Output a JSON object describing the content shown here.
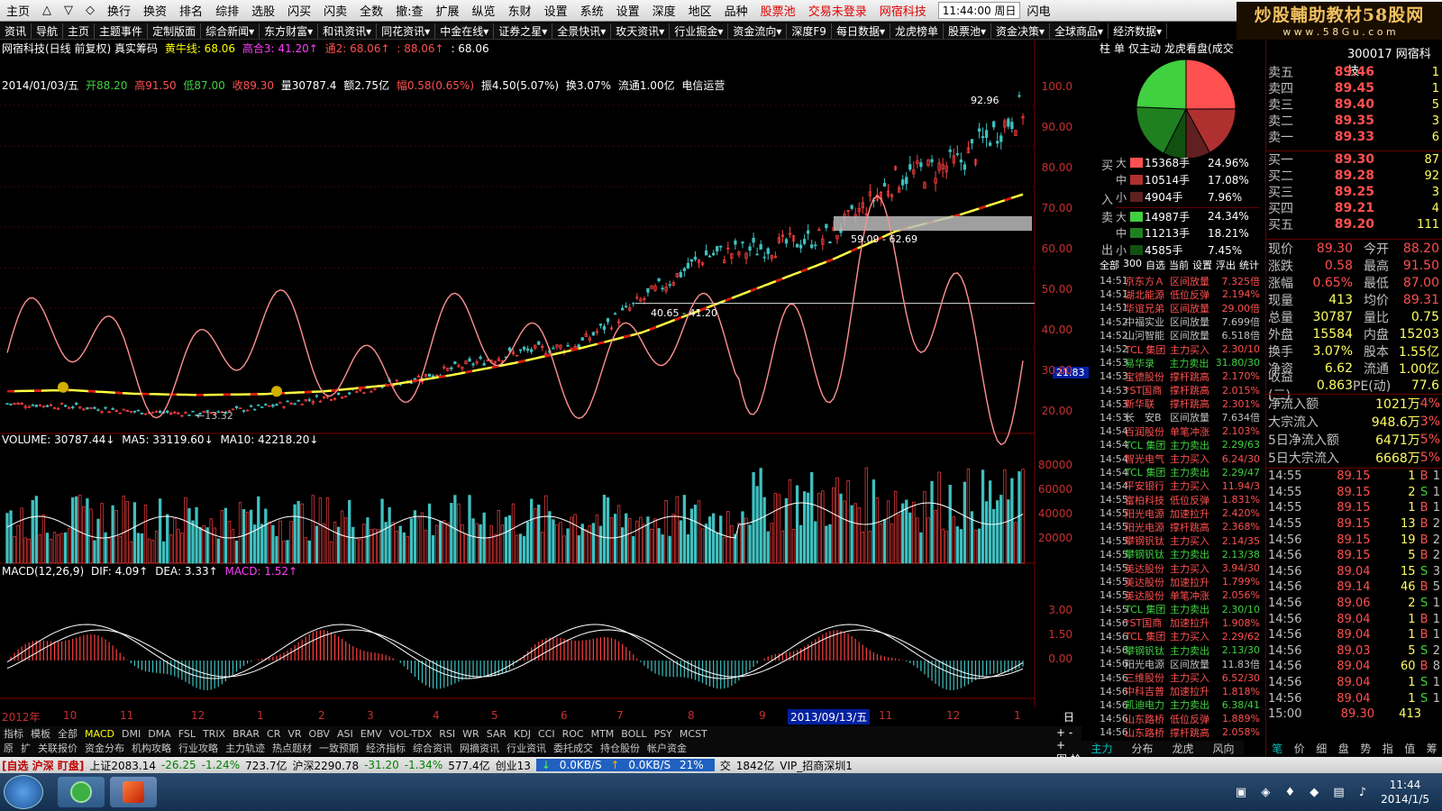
{
  "menu": {
    "items": [
      "主页",
      "△",
      "▽",
      "◇",
      "换行",
      "换资",
      "排名",
      "综排",
      "选股",
      "闪买",
      "闪卖",
      "全数",
      "撤:查",
      "扩展",
      "纵览",
      "东财",
      "设置",
      "系统",
      "设置",
      "深度",
      "地区",
      "品种"
    ],
    "red_items": [
      "股票池",
      "交易未登录",
      "网宿科技"
    ],
    "clock": "11:44:00 周日",
    "right": "闪电"
  },
  "watermark": {
    "title": "炒股輔助教材58股网",
    "url": "w w w . 5 8 G u . c o m"
  },
  "toolbar": [
    "资讯",
    "导航",
    "主页",
    "主题事件",
    "定制版面",
    "综合新闻▾",
    "东方财富▾",
    "和讯资讯▾",
    "同花资讯▾",
    "中金在线▾",
    "证券之星▾",
    "全景快讯▾",
    "玫天资讯▾",
    "行业掘金▾",
    "资金流向▾",
    "深度F9",
    "每日数据▾",
    "龙虎榜单",
    "股票池▾",
    "资金决策▾",
    "全球商品▾",
    "经济数据▾"
  ],
  "chart_header": {
    "stock": "网宿科技(日线 前复权) 真实筹码",
    "l1": "黄牛线: 68.06",
    "l2": "高合3: 41.20↑",
    "l3": "通2: 68.06↑",
    "l4": ": 88.06↑",
    "l5": ": 68.06"
  },
  "ohlc_bar": {
    "date": "2014/01/03/五",
    "open": "开88.20",
    "high": "高91.50",
    "low": "低87.00",
    "close": "收89.30",
    "vol": "量30787.4",
    "amt": "额2.75亿",
    "chg": "幅0.58(0.65%)",
    "amp": "振4.50(5.07%)",
    "turn": "换3.07%",
    "float": "流通1.00亿",
    "ind": "电信运营"
  },
  "price_axis": [
    "100.0",
    "90.00",
    "80.00",
    "70.00",
    "60.00",
    "50.00",
    "40.00",
    "30.00",
    "20.00"
  ],
  "annotations": {
    "hi": "92.96",
    "band1": "59.09 - 62.69",
    "band2": "40.65 - 41.20",
    "low": "←13.32",
    "cur": "21.83"
  },
  "volume": {
    "label": "VOLUME: 30787.44↓",
    "ma5": "MA5: 33119.60↓",
    "ma10": "MA10: 42218.20↓",
    "axis": [
      "80000",
      "60000",
      "40000",
      "20000"
    ]
  },
  "macd": {
    "label": "MACD(12,26,9)",
    "dif": "DIF: 4.09↑",
    "dea": "DEA: 3.33↑",
    "macd": "MACD: 1.52↑",
    "axis": [
      "3.00",
      "1.50",
      "0.00"
    ]
  },
  "time_axis": [
    "2012年",
    "10",
    "11",
    "12",
    "1",
    "2",
    "3",
    "4",
    "5",
    "6",
    "7",
    "8",
    "9",
    "2013/09/13/五",
    "11",
    "12",
    "1"
  ],
  "time_axis_right": "日线",
  "chart_data": {
    "type": "candlestick",
    "title": "网宿科技(日线 前复权)",
    "ylim": [
      13,
      100
    ],
    "x": [
      "2012-09",
      "2012-10",
      "2012-11",
      "2012-12",
      "2013-01",
      "2013-02",
      "2013-03",
      "2013-04",
      "2013-05",
      "2013-06",
      "2013-07",
      "2013-08",
      "2013-09",
      "2013-10",
      "2013-11",
      "2013-12",
      "2014-01"
    ],
    "series": [
      {
        "name": "收盘",
        "values": [
          16.5,
          15.8,
          14.5,
          14.0,
          15.5,
          18.0,
          21.0,
          25.0,
          29.0,
          31.0,
          42.0,
          53.0,
          55.0,
          58.0,
          72.0,
          76.0,
          89.3
        ]
      },
      {
        "name": "黄牛线",
        "values": [
          19.5,
          19.8,
          18.9,
          18.6,
          18.8,
          19.5,
          21.0,
          23.5,
          26.5,
          30.0,
          34.0,
          40.0,
          46.0,
          52.0,
          59.0,
          63.0,
          68.06
        ]
      }
    ],
    "last_bar": {
      "open": 88.2,
      "high": 91.5,
      "low": 87.0,
      "close": 89.3,
      "volume": 30787.4
    }
  },
  "tabs_bottom_1": [
    "指标",
    "模板",
    "全部",
    "MACD",
    "DMI",
    "DMA",
    "FSL",
    "TRIX",
    "BRAR",
    "CR",
    "VR",
    "OBV",
    "ASI",
    "EMV",
    "VOL-TDX",
    "RSI",
    "WR",
    "SAR",
    "KDJ",
    "CCI",
    "ROC",
    "MTM",
    "BOLL",
    "PSY",
    "MCST"
  ],
  "tabs_bottom_2": [
    "原",
    "扩",
    "关联报价",
    "资金分布",
    "机构攻略",
    "行业攻略",
    "主力轨迹",
    "热点题材",
    "一致预期",
    "经济指标",
    "综合资讯",
    "网摘资讯",
    "行业资讯",
    "委托成交",
    "持仓股份",
    "帐户资金"
  ],
  "pie": {
    "header": [
      "柱",
      "单",
      "仅主动",
      "龙虎看盘(成交"
    ],
    "buy_label": "买",
    "buy_sub": "入",
    "sell_label": "卖",
    "sell_sub": "出",
    "rows": [
      {
        "side": "大",
        "val": "15368手",
        "pct": "24.96%",
        "color": "#ff5050"
      },
      {
        "side": "中",
        "val": "10514手",
        "pct": "17.08%",
        "color": "#b03030"
      },
      {
        "side": "小",
        "val": "4904手",
        "pct": "7.96%",
        "color": "#602020"
      },
      {
        "side": "大",
        "val": "14987手",
        "pct": "24.34%",
        "color": "#40d040"
      },
      {
        "side": "中",
        "val": "11213手",
        "pct": "18.21%",
        "color": "#208020"
      },
      {
        "side": "小",
        "val": "4585手",
        "pct": "7.45%",
        "color": "#105010"
      }
    ]
  },
  "news_tabs": [
    "全部",
    "300",
    "自选",
    "当前",
    "设置",
    "浮出",
    "统计"
  ],
  "news": [
    {
      "t": "14:51",
      "n": "京东方Ａ",
      "k": "区间放量",
      "v": "7.325倍",
      "c": "#ff5050"
    },
    {
      "t": "14:51",
      "n": "湖北能源",
      "k": "低位反弹",
      "v": "2.194%",
      "c": "#ff5050"
    },
    {
      "t": "14:51",
      "n": "华谊兄弟",
      "k": "区间放量",
      "v": "29.00倍",
      "c": "#ff5050"
    },
    {
      "t": "14:52",
      "n": "中福实业",
      "k": "区间放量",
      "v": "7.699倍",
      "c": "#c0c0c0"
    },
    {
      "t": "14:52",
      "n": "山河智能",
      "k": "区间放量",
      "v": "6.518倍",
      "c": "#c0c0c0"
    },
    {
      "t": "14:52",
      "n": "TCL 集团",
      "k": "主力买入",
      "v": "2.30/10",
      "c": "#ff5050"
    },
    {
      "t": "14:53",
      "n": "易华录",
      "k": "主力卖出",
      "v": "31.80/30",
      "c": "#40d040"
    },
    {
      "t": "14:53",
      "n": "宝德股份",
      "k": "撑杆跳高",
      "v": "2.170%",
      "c": "#ff5050"
    },
    {
      "t": "14:53",
      "n": "*ST国商",
      "k": "撑杆跳高",
      "v": "2.015%",
      "c": "#ff5050"
    },
    {
      "t": "14:53",
      "n": "新华联",
      "k": "撑杆跳高",
      "v": "2.301%",
      "c": "#ff5050"
    },
    {
      "t": "14:53",
      "n": "长　安B",
      "k": "区间放量",
      "v": "7.634倍",
      "c": "#c0c0c0"
    },
    {
      "t": "14:54",
      "n": "百润股份",
      "k": "单笔冲涨",
      "v": "2.103%",
      "c": "#ff5050"
    },
    {
      "t": "14:54",
      "n": "TCL 集团",
      "k": "主力卖出",
      "v": "2.29/63",
      "c": "#40d040"
    },
    {
      "t": "14:54",
      "n": "智光电气",
      "k": "主力买入",
      "v": "6.24/30",
      "c": "#ff5050"
    },
    {
      "t": "14:54",
      "n": "TCL 集团",
      "k": "主力卖出",
      "v": "2.29/47",
      "c": "#40d040"
    },
    {
      "t": "14:54",
      "n": "平安银行",
      "k": "主力买入",
      "v": "11.94/3",
      "c": "#ff5050"
    },
    {
      "t": "14:55",
      "n": "富柏科技",
      "k": "低位反弹",
      "v": "1.831%",
      "c": "#ff5050"
    },
    {
      "t": "14:55",
      "n": "阳光电源",
      "k": "加速拉升",
      "v": "2.420%",
      "c": "#ff5050"
    },
    {
      "t": "14:55",
      "n": "阳光电源",
      "k": "撑杆跳高",
      "v": "2.368%",
      "c": "#ff5050"
    },
    {
      "t": "14:55",
      "n": "攀钢钒钛",
      "k": "主力买入",
      "v": "2.14/35",
      "c": "#ff5050"
    },
    {
      "t": "14:55",
      "n": "攀钢钒钛",
      "k": "主力卖出",
      "v": "2.13/38",
      "c": "#40d040"
    },
    {
      "t": "14:55",
      "n": "美达股份",
      "k": "主力买入",
      "v": "3.94/30",
      "c": "#ff5050"
    },
    {
      "t": "14:55",
      "n": "美达股份",
      "k": "加速拉升",
      "v": "1.799%",
      "c": "#ff5050"
    },
    {
      "t": "14:55",
      "n": "美达股份",
      "k": "单笔冲涨",
      "v": "2.056%",
      "c": "#ff5050"
    },
    {
      "t": "14:55",
      "n": "TCL 集团",
      "k": "主力卖出",
      "v": "2.30/10",
      "c": "#40d040"
    },
    {
      "t": "14:56",
      "n": "*ST国商",
      "k": "加速拉升",
      "v": "1.908%",
      "c": "#ff5050"
    },
    {
      "t": "14:56",
      "n": "TCL 集团",
      "k": "主力买入",
      "v": "2.29/62",
      "c": "#ff5050"
    },
    {
      "t": "14:56",
      "n": "攀钢钒钛",
      "k": "主力卖出",
      "v": "2.13/30",
      "c": "#40d040"
    },
    {
      "t": "14:56",
      "n": "阳光电源",
      "k": "区间放量",
      "v": "11.83倍",
      "c": "#c0c0c0"
    },
    {
      "t": "14:56",
      "n": "三维股份",
      "k": "主力买入",
      "v": "6.52/30",
      "c": "#ff5050"
    },
    {
      "t": "14:56",
      "n": "中科吉普",
      "k": "加速拉升",
      "v": "1.818%",
      "c": "#ff5050"
    },
    {
      "t": "14:56",
      "n": "凯迪电力",
      "k": "主力卖出",
      "v": "6.38/41",
      "c": "#40d040"
    },
    {
      "t": "14:56",
      "n": "山东路桥",
      "k": "低位反弹",
      "v": "1.889%",
      "c": "#ff5050"
    },
    {
      "t": "14:56",
      "n": "山东路桥",
      "k": "撑杆跳高",
      "v": "2.058%",
      "c": "#ff5050"
    }
  ],
  "quote": {
    "code": "300017 网宿科技",
    "sell": [
      [
        "卖五",
        "89.46",
        "1"
      ],
      [
        "卖四",
        "89.45",
        "1"
      ],
      [
        "卖三",
        "89.40",
        "5"
      ],
      [
        "卖二",
        "89.35",
        "3"
      ],
      [
        "卖一",
        "89.33",
        "6"
      ]
    ],
    "buy": [
      [
        "买一",
        "89.30",
        "87"
      ],
      [
        "买二",
        "89.28",
        "92"
      ],
      [
        "买三",
        "89.25",
        "3"
      ],
      [
        "买四",
        "89.21",
        "4"
      ],
      [
        "买五",
        "89.20",
        "111"
      ]
    ],
    "stats": [
      [
        "现价",
        "89.30",
        "今开",
        "88.20"
      ],
      [
        "涨跌",
        "0.58",
        "最高",
        "91.50"
      ],
      [
        "涨幅",
        "0.65%",
        "最低",
        "87.00"
      ],
      [
        "现量",
        "413",
        "均价",
        "89.31"
      ],
      [
        "总量",
        "30787",
        "量比",
        "0.75"
      ],
      [
        "外盘",
        "15584",
        "内盘",
        "15203"
      ],
      [
        "换手",
        "3.07%",
        "股本",
        "1.55亿"
      ],
      [
        "净资",
        "6.62",
        "流通",
        "1.00亿"
      ],
      [
        "收益(三)",
        "0.863",
        "PE(动)",
        "77.6"
      ]
    ],
    "moneyflow": [
      [
        "净流入额",
        "1021万",
        "4%"
      ],
      [
        "大宗流入",
        "948.6万",
        "3%"
      ],
      [
        "5日净流入额",
        "6471万",
        "5%"
      ],
      [
        "5日大宗流入",
        "6668万",
        "5%"
      ]
    ],
    "ticks": [
      [
        "14:55",
        "89.15",
        "1",
        "B",
        "1"
      ],
      [
        "14:55",
        "89.15",
        "2",
        "S",
        "1"
      ],
      [
        "14:55",
        "89.15",
        "1",
        "B",
        "1"
      ],
      [
        "14:55",
        "89.15",
        "13",
        "B",
        "2"
      ],
      [
        "14:56",
        "89.15",
        "19",
        "B",
        "2"
      ],
      [
        "14:56",
        "89.15",
        "5",
        "B",
        "2"
      ],
      [
        "14:56",
        "89.04",
        "15",
        "S",
        "3"
      ],
      [
        "14:56",
        "89.14",
        "46",
        "B",
        "5"
      ],
      [
        "14:56",
        "89.06",
        "2",
        "S",
        "1"
      ],
      [
        "14:56",
        "89.04",
        "1",
        "B",
        "1"
      ],
      [
        "14:56",
        "89.04",
        "1",
        "B",
        "1"
      ],
      [
        "14:56",
        "89.03",
        "5",
        "S",
        "2"
      ],
      [
        "14:56",
        "89.04",
        "60",
        "B",
        "8"
      ],
      [
        "14:56",
        "89.04",
        "1",
        "S",
        "1"
      ],
      [
        "14:56",
        "89.04",
        "1",
        "S",
        "1"
      ],
      [
        "15:00",
        "89.30",
        "413",
        "",
        ""
      ]
    ],
    "tick_tail": "92"
  },
  "right_tabs": [
    "主力",
    "分布",
    "龙虎",
    "风向"
  ],
  "far_tabs": [
    "笔",
    "价",
    "细",
    "盘",
    "势",
    "指",
    "值",
    "筹"
  ],
  "status": {
    "s1": "[自选 沪深 盯盘]",
    "s2": "上证2083.14",
    "s3": "-26.25",
    "s4": "-1.24%",
    "s5": "723.7亿",
    "s6": "沪深2290.78",
    "s7": "-31.20",
    "s8": "-1.34%",
    "s9": "577.4亿",
    "s10": "创业13",
    "net1": "0.0KB/S",
    "net2": "0.0KB/S",
    "net3": "21%",
    "s11": "交",
    "s12": "1842亿",
    "s13": "VIP_招商深圳1"
  },
  "taskbar": {
    "time": "11:44",
    "date": "2014/1/5"
  }
}
